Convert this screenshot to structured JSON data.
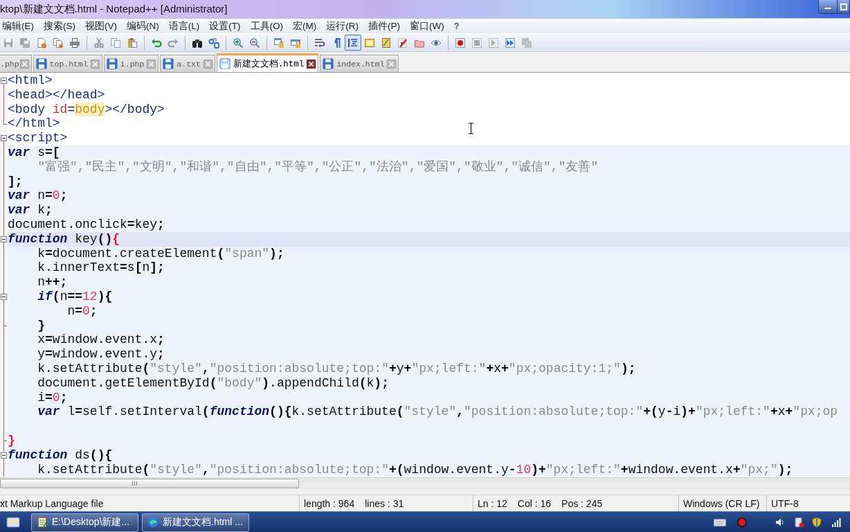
{
  "window": {
    "title": "ktop\\新建文文档.html - Notepad++ [Administrator]"
  },
  "menu": [
    "编辑(E)",
    "搜索(S)",
    "视图(V)",
    "编码(N)",
    "语言(L)",
    "设置(T)",
    "工具(O)",
    "宏(M)",
    "运行(R)",
    "插件(P)",
    "窗口(W)",
    "?"
  ],
  "toolbar": {
    "groups": [
      [
        {
          "kind": "save",
          "disabled": true,
          "pressed": false
        },
        {
          "kind": "saveall",
          "disabled": true,
          "pressed": false
        },
        {
          "kind": "close",
          "disabled": false,
          "pressed": false
        },
        {
          "kind": "closeall",
          "disabled": false,
          "pressed": false
        },
        {
          "kind": "print",
          "disabled": false,
          "pressed": false
        }
      ],
      [
        {
          "kind": "cut",
          "disabled": true,
          "pressed": false
        },
        {
          "kind": "copy",
          "disabled": true,
          "pressed": false
        },
        {
          "kind": "paste",
          "disabled": false,
          "pressed": false
        }
      ],
      [
        {
          "kind": "undo",
          "disabled": false,
          "pressed": false
        },
        {
          "kind": "redo",
          "disabled": true,
          "pressed": false
        }
      ],
      [
        {
          "kind": "find",
          "disabled": false,
          "pressed": false
        },
        {
          "kind": "replace",
          "disabled": false,
          "pressed": false
        }
      ],
      [
        {
          "kind": "zoomin",
          "disabled": false,
          "pressed": false
        },
        {
          "kind": "zoomout",
          "disabled": false,
          "pressed": false
        }
      ],
      [
        {
          "kind": "syncv",
          "disabled": false,
          "pressed": false
        },
        {
          "kind": "synch",
          "disabled": false,
          "pressed": false
        }
      ],
      [
        {
          "kind": "wrap",
          "disabled": false,
          "pressed": false
        },
        {
          "kind": "symbols",
          "disabled": false,
          "pressed": false
        },
        {
          "kind": "indent",
          "disabled": false,
          "pressed": true
        },
        {
          "kind": "language",
          "disabled": false,
          "pressed": false
        },
        {
          "kind": "docmap",
          "disabled": false,
          "pressed": false
        },
        {
          "kind": "funclist",
          "disabled": false,
          "pressed": false
        },
        {
          "kind": "folder",
          "disabled": false,
          "pressed": false
        },
        {
          "kind": "monitor",
          "disabled": false,
          "pressed": false
        }
      ],
      [
        {
          "kind": "record",
          "disabled": false,
          "pressed": false
        },
        {
          "kind": "stop",
          "disabled": true,
          "pressed": false
        },
        {
          "kind": "play",
          "disabled": true,
          "pressed": false
        },
        {
          "kind": "runmulti",
          "disabled": false,
          "pressed": false
        },
        {
          "kind": "savemacro",
          "disabled": true,
          "pressed": false
        }
      ]
    ]
  },
  "tabs": [
    {
      "kind": "partial",
      "label": ".php",
      "selected": false
    },
    {
      "kind": "file",
      "label": "top.html",
      "selected": false
    },
    {
      "kind": "file",
      "label": "i.php",
      "selected": false
    },
    {
      "kind": "file",
      "label": "a.txt",
      "selected": false
    },
    {
      "kind": "file",
      "label": "新建文文档.html",
      "selected": true
    },
    {
      "kind": "file",
      "label": "index.html",
      "selected": false
    }
  ],
  "editor": {
    "lines": [
      {
        "kind": "html",
        "current": false,
        "fold_start": true,
        "fold_end": false,
        "tokens": [
          {
            "kind": "tag",
            "text": "<html>"
          }
        ]
      },
      {
        "kind": "html",
        "current": false,
        "fold_start": false,
        "fold_end": false,
        "tokens": [
          {
            "kind": "tag",
            "text": "<head></head>"
          }
        ]
      },
      {
        "kind": "html",
        "current": false,
        "fold_start": false,
        "fold_end": false,
        "tokens": [
          {
            "kind": "tag",
            "text": "<body "
          },
          {
            "kind": "attr",
            "text": "id"
          },
          {
            "kind": "plain",
            "text": "="
          },
          {
            "kind": "value",
            "text": "body"
          },
          {
            "kind": "tag",
            "text": "></body>"
          }
        ]
      },
      {
        "kind": "html",
        "current": false,
        "fold_start": false,
        "fold_end": true,
        "tokens": [
          {
            "kind": "tag",
            "text": "</html>"
          }
        ]
      },
      {
        "kind": "html",
        "current": false,
        "fold_start": true,
        "fold_end": false,
        "tokens": [
          {
            "kind": "tag",
            "text": "<script>"
          }
        ]
      },
      {
        "kind": "script",
        "current": false,
        "fold_start": false,
        "fold_end": false,
        "tokens": [
          {
            "kind": "keyword",
            "text": "var"
          },
          {
            "kind": "ident",
            "text": " s"
          },
          {
            "kind": "op",
            "text": "=["
          }
        ]
      },
      {
        "kind": "script",
        "current": false,
        "fold_start": false,
        "fold_end": false,
        "tokens": [
          {
            "kind": "string",
            "text": "    \"富强\",\"民主\",\"文明\",\"和谐\",\"自由\",\"平等\",\"公正\",\"法治\",\"爱国\",\"敬业\",\"诚信\",\"友善\""
          }
        ]
      },
      {
        "kind": "script",
        "current": false,
        "fold_start": false,
        "fold_end": false,
        "tokens": [
          {
            "kind": "op",
            "text": "];"
          }
        ]
      },
      {
        "kind": "script",
        "current": false,
        "fold_start": false,
        "fold_end": false,
        "tokens": [
          {
            "kind": "keyword",
            "text": "var"
          },
          {
            "kind": "ident",
            "text": " n"
          },
          {
            "kind": "op",
            "text": "="
          },
          {
            "kind": "number",
            "text": "0"
          },
          {
            "kind": "op",
            "text": ";"
          }
        ]
      },
      {
        "kind": "script",
        "current": false,
        "fold_start": false,
        "fold_end": false,
        "tokens": [
          {
            "kind": "keyword",
            "text": "var"
          },
          {
            "kind": "ident",
            "text": " k"
          },
          {
            "kind": "op",
            "text": ";"
          }
        ]
      },
      {
        "kind": "script",
        "current": false,
        "fold_start": false,
        "fold_end": false,
        "tokens": [
          {
            "kind": "ident",
            "text": "document.onclick"
          },
          {
            "kind": "op",
            "text": "="
          },
          {
            "kind": "ident",
            "text": "key"
          },
          {
            "kind": "op",
            "text": ";"
          }
        ]
      },
      {
        "kind": "script",
        "current": true,
        "fold_start": true,
        "fold_end": false,
        "tokens": [
          {
            "kind": "keyword",
            "text": "function"
          },
          {
            "kind": "ident",
            "text": " key"
          },
          {
            "kind": "op",
            "text": "()"
          },
          {
            "kind": "brace",
            "text": "{"
          }
        ]
      },
      {
        "kind": "script",
        "current": false,
        "fold_start": false,
        "fold_end": false,
        "tokens": [
          {
            "kind": "ident",
            "text": "    k"
          },
          {
            "kind": "op",
            "text": "="
          },
          {
            "kind": "ident",
            "text": "document.createElement"
          },
          {
            "kind": "op",
            "text": "("
          },
          {
            "kind": "string",
            "text": "\"span\""
          },
          {
            "kind": "op",
            "text": ");"
          }
        ]
      },
      {
        "kind": "script",
        "current": false,
        "fold_start": false,
        "fold_end": false,
        "tokens": [
          {
            "kind": "ident",
            "text": "    k.innerText"
          },
          {
            "kind": "op",
            "text": "="
          },
          {
            "kind": "ident",
            "text": "s"
          },
          {
            "kind": "op",
            "text": "["
          },
          {
            "kind": "ident",
            "text": "n"
          },
          {
            "kind": "op",
            "text": "];"
          }
        ]
      },
      {
        "kind": "script",
        "current": false,
        "fold_start": false,
        "fold_end": false,
        "tokens": [
          {
            "kind": "ident",
            "text": "    n"
          },
          {
            "kind": "op",
            "text": "++;"
          }
        ]
      },
      {
        "kind": "script",
        "current": false,
        "fold_start": true,
        "fold_end": false,
        "tokens": [
          {
            "kind": "keyword",
            "text": "    if"
          },
          {
            "kind": "op",
            "text": "("
          },
          {
            "kind": "ident",
            "text": "n"
          },
          {
            "kind": "op",
            "text": "=="
          },
          {
            "kind": "number",
            "text": "12"
          },
          {
            "kind": "op",
            "text": "){"
          }
        ]
      },
      {
        "kind": "script",
        "current": false,
        "fold_start": false,
        "fold_end": false,
        "tokens": [
          {
            "kind": "ident",
            "text": "        n"
          },
          {
            "kind": "op",
            "text": "="
          },
          {
            "kind": "number",
            "text": "0"
          },
          {
            "kind": "op",
            "text": ";"
          }
        ]
      },
      {
        "kind": "script",
        "current": false,
        "fold_start": false,
        "fold_end": true,
        "tokens": [
          {
            "kind": "op",
            "text": "    }"
          }
        ]
      },
      {
        "kind": "script",
        "current": false,
        "fold_start": false,
        "fold_end": false,
        "tokens": [
          {
            "kind": "ident",
            "text": "    x"
          },
          {
            "kind": "op",
            "text": "="
          },
          {
            "kind": "ident",
            "text": "window.event.x"
          },
          {
            "kind": "op",
            "text": ";"
          }
        ]
      },
      {
        "kind": "script",
        "current": false,
        "fold_start": false,
        "fold_end": false,
        "tokens": [
          {
            "kind": "ident",
            "text": "    y"
          },
          {
            "kind": "op",
            "text": "="
          },
          {
            "kind": "ident",
            "text": "window.event.y"
          },
          {
            "kind": "op",
            "text": ";"
          }
        ]
      },
      {
        "kind": "script",
        "current": false,
        "fold_start": false,
        "fold_end": false,
        "tokens": [
          {
            "kind": "ident",
            "text": "    k.setAttribute"
          },
          {
            "kind": "op",
            "text": "("
          },
          {
            "kind": "string",
            "text": "\"style\""
          },
          {
            "kind": "op",
            "text": ","
          },
          {
            "kind": "string",
            "text": "\"position:absolute;top:\""
          },
          {
            "kind": "op",
            "text": "+"
          },
          {
            "kind": "ident",
            "text": "y"
          },
          {
            "kind": "op",
            "text": "+"
          },
          {
            "kind": "string",
            "text": "\"px;left:\""
          },
          {
            "kind": "op",
            "text": "+"
          },
          {
            "kind": "ident",
            "text": "x"
          },
          {
            "kind": "op",
            "text": "+"
          },
          {
            "kind": "string",
            "text": "\"px;opacity:1;\""
          },
          {
            "kind": "op",
            "text": ");"
          }
        ]
      },
      {
        "kind": "script",
        "current": false,
        "fold_start": false,
        "fold_end": false,
        "tokens": [
          {
            "kind": "ident",
            "text": "    document.getElementById"
          },
          {
            "kind": "op",
            "text": "("
          },
          {
            "kind": "string",
            "text": "\"body\""
          },
          {
            "kind": "op",
            "text": ")"
          },
          {
            "kind": "ident",
            "text": ".appendChild"
          },
          {
            "kind": "op",
            "text": "("
          },
          {
            "kind": "ident",
            "text": "k"
          },
          {
            "kind": "op",
            "text": ");"
          }
        ]
      },
      {
        "kind": "script",
        "current": false,
        "fold_start": false,
        "fold_end": false,
        "tokens": [
          {
            "kind": "ident",
            "text": "    i"
          },
          {
            "kind": "op",
            "text": "="
          },
          {
            "kind": "number",
            "text": "0"
          },
          {
            "kind": "op",
            "text": ";"
          }
        ]
      },
      {
        "kind": "script",
        "current": false,
        "fold_start": false,
        "fold_end": false,
        "tokens": [
          {
            "kind": "keyword",
            "text": "    var"
          },
          {
            "kind": "ident",
            "text": " l"
          },
          {
            "kind": "op",
            "text": "="
          },
          {
            "kind": "ident",
            "text": "self.setInterval"
          },
          {
            "kind": "op",
            "text": "("
          },
          {
            "kind": "keyword",
            "text": "function"
          },
          {
            "kind": "op",
            "text": "(){"
          },
          {
            "kind": "ident",
            "text": "k.setAttribute"
          },
          {
            "kind": "op",
            "text": "("
          },
          {
            "kind": "string",
            "text": "\"style\""
          },
          {
            "kind": "op",
            "text": ","
          },
          {
            "kind": "string",
            "text": "\"position:absolute;top:\""
          },
          {
            "kind": "op",
            "text": "+("
          },
          {
            "kind": "ident",
            "text": "y"
          },
          {
            "kind": "op",
            "text": "-"
          },
          {
            "kind": "ident",
            "text": "i"
          },
          {
            "kind": "op",
            "text": ")+"
          },
          {
            "kind": "string",
            "text": "\"px;left:\""
          },
          {
            "kind": "op",
            "text": "+"
          },
          {
            "kind": "ident",
            "text": "x"
          },
          {
            "kind": "op",
            "text": "+"
          },
          {
            "kind": "string",
            "text": "\"px;op"
          }
        ]
      },
      {
        "kind": "script",
        "current": false,
        "fold_start": false,
        "fold_end": false
      },
      {
        "kind": "script",
        "current": false,
        "fold_start": false,
        "fold_end": true,
        "tokens": [
          {
            "kind": "brace",
            "text": "}"
          }
        ]
      },
      {
        "kind": "script",
        "current": false,
        "fold_start": true,
        "fold_end": false,
        "tokens": [
          {
            "kind": "keyword",
            "text": "function"
          },
          {
            "kind": "ident",
            "text": " ds"
          },
          {
            "kind": "op",
            "text": "(){"
          }
        ]
      },
      {
        "kind": "script",
        "current": false,
        "fold_start": false,
        "fold_end": false,
        "tokens": [
          {
            "kind": "ident",
            "text": "    k.setAttribute"
          },
          {
            "kind": "op",
            "text": "("
          },
          {
            "kind": "string",
            "text": "\"style\""
          },
          {
            "kind": "op",
            "text": ","
          },
          {
            "kind": "string",
            "text": "\"position:absolute;top:\""
          },
          {
            "kind": "op",
            "text": "+("
          },
          {
            "kind": "ident",
            "text": "window.event.y"
          },
          {
            "kind": "op",
            "text": "-"
          },
          {
            "kind": "number",
            "text": "10"
          },
          {
            "kind": "op",
            "text": ")+"
          },
          {
            "kind": "string",
            "text": "\"px;left:\""
          },
          {
            "kind": "op",
            "text": "+"
          },
          {
            "kind": "ident",
            "text": "window.event.x"
          },
          {
            "kind": "op",
            "text": "+"
          },
          {
            "kind": "string",
            "text": "\"px;\""
          },
          {
            "kind": "op",
            "text": ");"
          }
        ]
      }
    ]
  },
  "status_bar": {
    "panels": [
      [
        "xt Markup Language file"
      ],
      [
        "length : 964",
        "lines : 31"
      ],
      [
        "Ln : 12",
        "Col : 16",
        "Pos : 245"
      ],
      [
        "Windows (CR LF)"
      ],
      [
        "UTF-8"
      ]
    ]
  },
  "taskbar": {
    "buttons": [
      {
        "kind": "editor",
        "label": "E:\\Desktop\\新建..."
      },
      {
        "kind": "browser",
        "label": "新建文文档.html ..."
      }
    ]
  }
}
